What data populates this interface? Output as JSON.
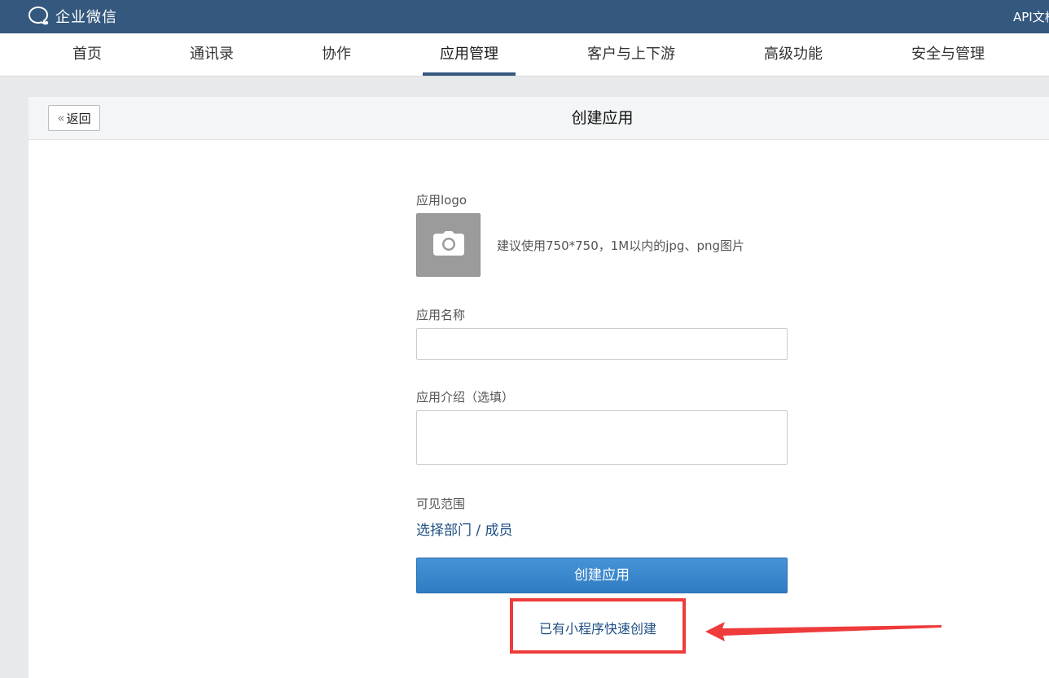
{
  "topbar": {
    "brand": "企业微信",
    "api_link": "API文档"
  },
  "nav": {
    "items": [
      {
        "label": "首页"
      },
      {
        "label": "通讯录"
      },
      {
        "label": "协作"
      },
      {
        "label": "应用管理",
        "active": true
      },
      {
        "label": "客户与上下游"
      },
      {
        "label": "高级功能"
      },
      {
        "label": "安全与管理"
      }
    ]
  },
  "panel": {
    "back_label": "返回",
    "title": "创建应用"
  },
  "form": {
    "logo_label": "应用logo",
    "logo_hint": "建议使用750*750，1M以内的jpg、png图片",
    "name_label": "应用名称",
    "name_value": "",
    "intro_label": "应用介绍（选填）",
    "intro_value": "",
    "scope_label": "可见范围",
    "scope_link": "选择部门 / 成员",
    "submit_label": "创建应用",
    "quick_create_label": "已有小程序快速创建"
  },
  "colors": {
    "topbar": "#34587e",
    "primary_button": "#3a86cc",
    "link": "#1f4f84",
    "annotation_red": "#ee3b3b"
  }
}
